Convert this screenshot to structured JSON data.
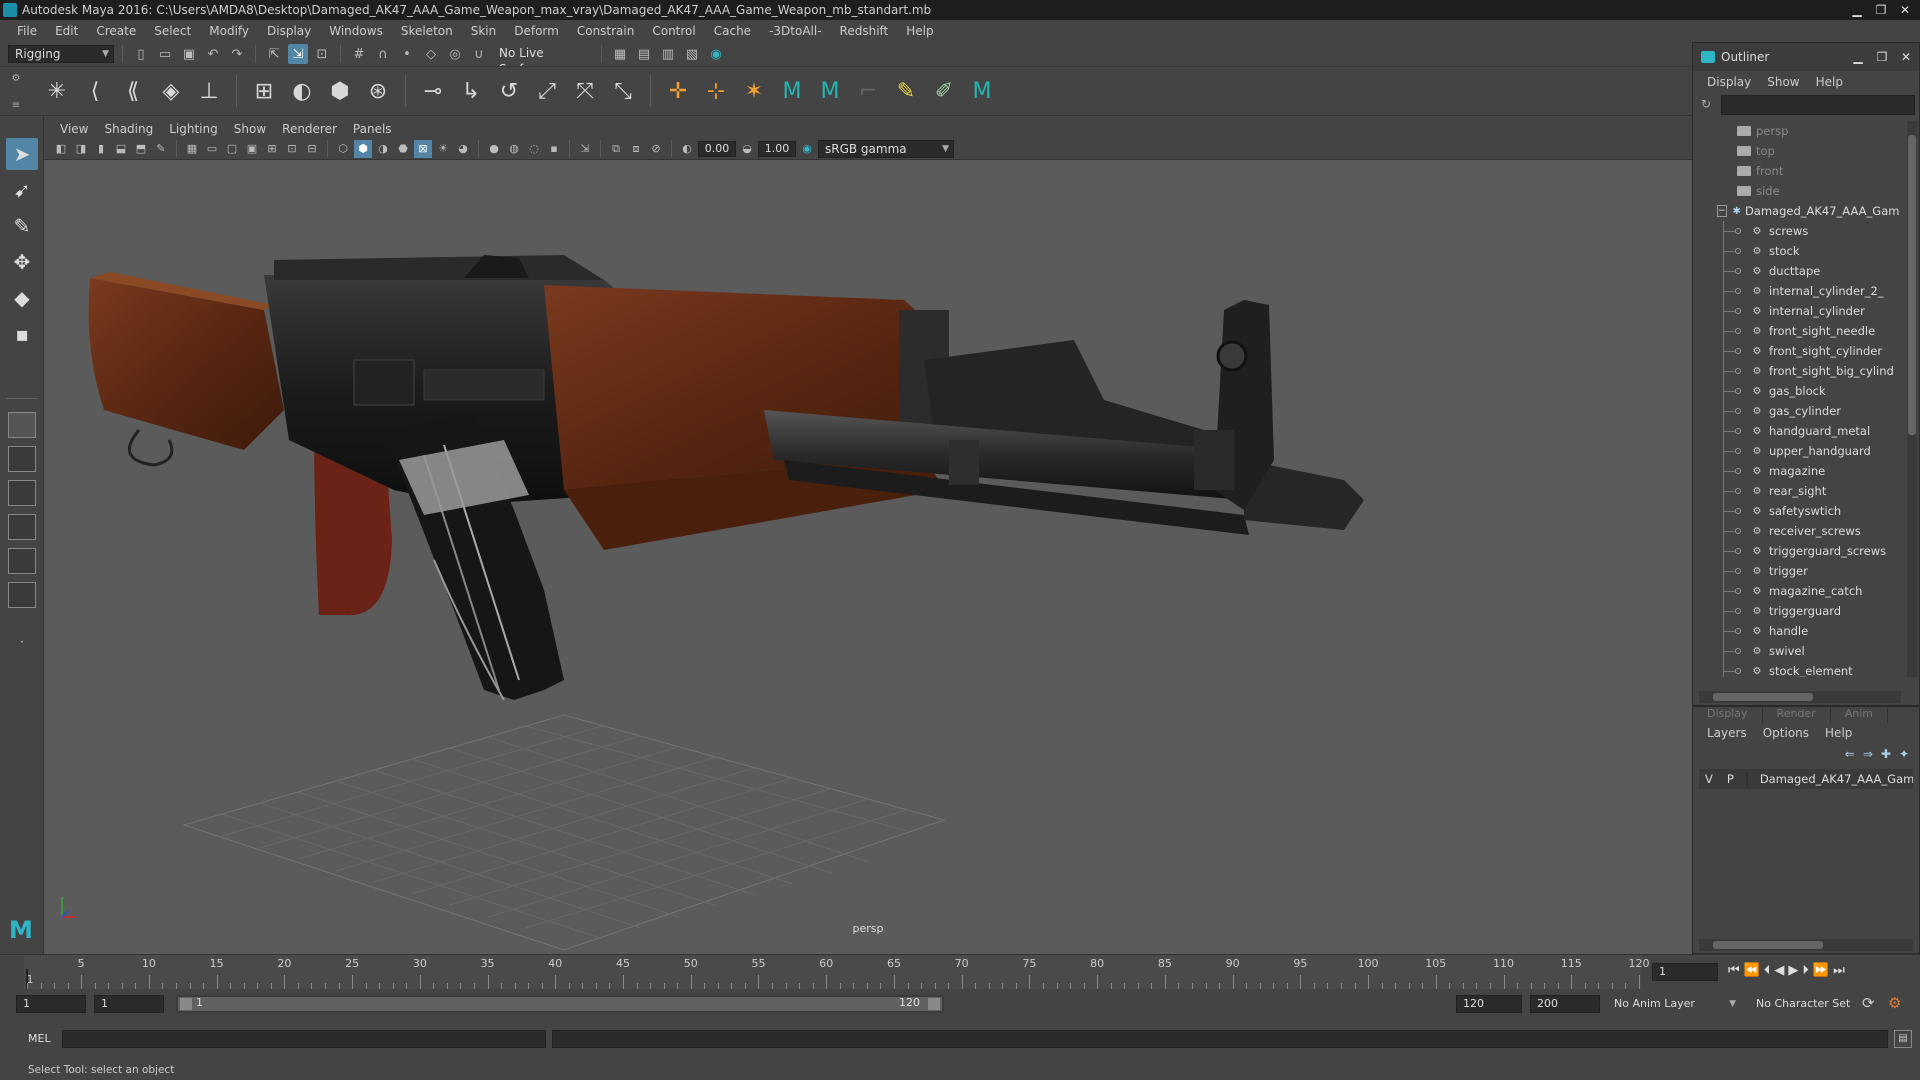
{
  "window": {
    "title": "Autodesk Maya 2016: C:\\Users\\AMDA8\\Desktop\\Damaged_AK47_AAA_Game_Weapon_max_vray\\Damaged_AK47_AAA_Game_Weapon_mb_standart.mb",
    "minimize": "▁",
    "maximize": "❐",
    "close": "✕"
  },
  "menubar": [
    "File",
    "Edit",
    "Create",
    "Select",
    "Modify",
    "Display",
    "Windows",
    "Skeleton",
    "Skin",
    "Deform",
    "Constrain",
    "Control",
    "Cache",
    "-3DtoAll-",
    "Redshift",
    "Help"
  ],
  "statusline": {
    "menuset": "Rigging",
    "live_surface": "No Live Surface"
  },
  "viewport": {
    "menus": [
      "View",
      "Shading",
      "Lighting",
      "Show",
      "Renderer",
      "Panels"
    ],
    "exposure": "0.00",
    "gamma": "1.00",
    "color_space": "sRGB gamma",
    "camera_label": "persp"
  },
  "outliner": {
    "title": "Outliner",
    "menus": [
      "Display",
      "Show",
      "Help"
    ],
    "cameras": [
      "persp",
      "top",
      "front",
      "side"
    ],
    "group": "Damaged_AK47_AAA_Gam",
    "children": [
      "screws",
      "stock",
      "ducttape",
      "internal_cylinder_2_",
      "internal_cylinder",
      "front_sight_needle",
      "front_sight_cylinder",
      "front_sight_big_cylind",
      "gas_block",
      "gas_cylinder",
      "handguard_metal",
      "upper_handguard",
      "magazine",
      "rear_sight",
      "safetyswtich",
      "receiver_screws",
      "triggerguard_screws",
      "trigger",
      "magazine_catch",
      "triggerguard",
      "handle",
      "swivel",
      "stock_element"
    ]
  },
  "layer_editor": {
    "tabs": [
      "Display",
      "Render",
      "Anim"
    ],
    "menus": [
      "Layers",
      "Options",
      "Help"
    ],
    "layer": {
      "v": "V",
      "p": "P",
      "name": "Damaged_AK47_AAA_Gam",
      "color": "#a8102a"
    }
  },
  "timeline": {
    "ticks": [
      "5",
      "10",
      "15",
      "20",
      "25",
      "30",
      "35",
      "40",
      "45",
      "50",
      "55",
      "60",
      "65",
      "70",
      "75",
      "80",
      "85",
      "90",
      "95",
      "100",
      "105",
      "110",
      "115",
      "120"
    ],
    "start_marker": "1",
    "current_frame": "1"
  },
  "range": {
    "start": "1",
    "playback_start": "1",
    "slider_start": "1",
    "slider_end": "120",
    "playback_end": "120",
    "end": "200",
    "anim_layer": "No Anim Layer",
    "character_set": "No Character Set"
  },
  "cmdline": {
    "label": "MEL"
  },
  "helpline": {
    "text": "Select Tool: select an object"
  }
}
